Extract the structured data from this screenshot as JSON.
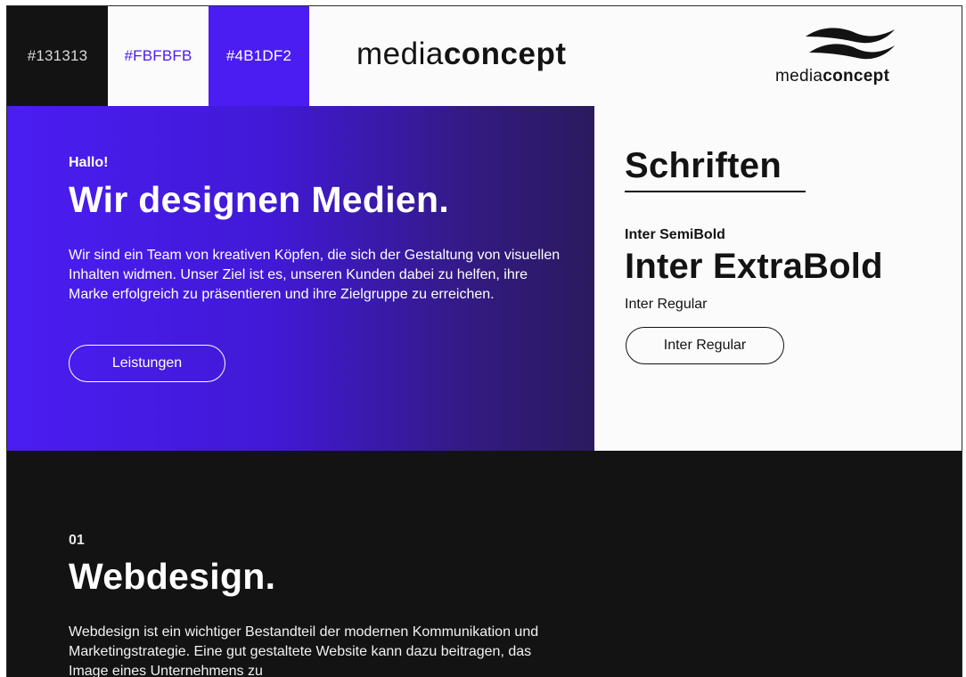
{
  "palette": {
    "swatches": [
      {
        "label": "#131313",
        "color": "#131313"
      },
      {
        "label": "#FBFBFB",
        "color": "#FBFBFB"
      },
      {
        "label": "#4B1DF2",
        "color": "#4B1DF2"
      }
    ]
  },
  "brand": {
    "wordmark_light": "media",
    "wordmark_bold": "concept",
    "logo_light": "media",
    "logo_bold": "concept",
    "logo_icon": "wave-icon"
  },
  "hero": {
    "kicker": "Hallo!",
    "title": "Wir designen Medien.",
    "text": "Wir sind ein Team von kreativen Köpfen, die sich der Gestaltung von visuellen Inhalten widmen. Unser Ziel ist es, unseren Kunden dabei zu helfen, ihre Marke erfolgreich zu präsentieren und ihre Zielgruppe zu erreichen.",
    "button_label": "Leistungen"
  },
  "fonts": {
    "title": "Schriften",
    "semibold": "Inter SemiBold",
    "extrabold": "Inter ExtraBold",
    "regular": "Inter Regular",
    "button_label": "Inter Regular"
  },
  "section": {
    "number": "01",
    "title": "Webdesign.",
    "text": "Webdesign ist ein wichtiger Bestandteil der modernen Kommunikation und Marketingstrategie. Eine gut gestaltete Website kann dazu beitragen, das Image eines Unternehmens zu"
  }
}
